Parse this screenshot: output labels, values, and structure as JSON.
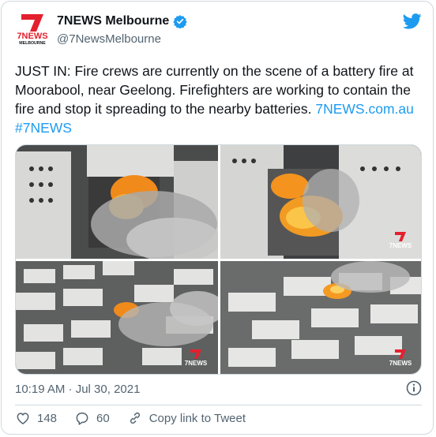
{
  "account": {
    "name": "7NEWS Melbourne",
    "handle": "@7NewsMelbourne",
    "logo_text": "7NEWS MELBOURNE",
    "verified_icon": "verified-badge-icon"
  },
  "tweet": {
    "text_prefix": "JUST IN: Fire crews are currently on the scene of a battery fire at Moorabool, near Geelong. Firefighters are working to contain the fire and stop it spreading to the nearby batteries. ",
    "link_url": "7NEWS.com.au",
    "hashtag": "#7NEWS"
  },
  "media": {
    "watermark": "7NEWS",
    "image_count": 4
  },
  "meta": {
    "timestamp": "10:19 AM · Jul 30, 2021"
  },
  "actions": {
    "likes": "148",
    "replies": "60",
    "copy_link": "Copy link to Tweet"
  },
  "colors": {
    "accent": "#1d9bf0",
    "brand_red": "#e4202e",
    "secondary_text": "#536471",
    "border": "#cfd9de"
  }
}
